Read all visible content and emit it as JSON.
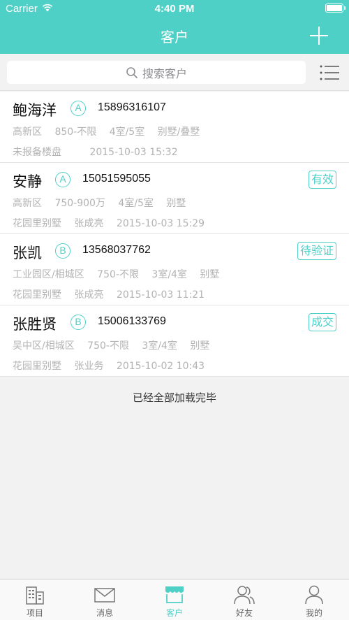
{
  "status_bar": {
    "carrier": "Carrier",
    "time": "4:40 PM"
  },
  "nav": {
    "title": "客户"
  },
  "search": {
    "placeholder": "搜索客户"
  },
  "customers": [
    {
      "name": "鲍海洋",
      "grade": "A",
      "phone": "15896316107",
      "district": "高新区",
      "budget": "850-不限",
      "rooms": "4室/5室",
      "type": "别墅/叠墅",
      "project": "未报备楼盘",
      "agent": "",
      "date": "2015-10-03 15:32",
      "status": ""
    },
    {
      "name": "安静",
      "grade": "A",
      "phone": "15051595055",
      "district": "高新区",
      "budget": "750-900万",
      "rooms": "4室/5室",
      "type": "别墅",
      "project": "花园里别墅",
      "agent": "张成亮",
      "date": "2015-10-03 15:29",
      "status": "有效"
    },
    {
      "name": "张凯",
      "grade": "B",
      "phone": "13568037762",
      "district": "工业园区/相城区",
      "budget": "750-不限",
      "rooms": "3室/4室",
      "type": "别墅",
      "project": "花园里别墅",
      "agent": "张成亮",
      "date": "2015-10-03 11:21",
      "status": "待验证"
    },
    {
      "name": "张胜贤",
      "grade": "B",
      "phone": "15006133769",
      "district": "吴中区/相城区",
      "budget": "750-不限",
      "rooms": "3室/4室",
      "type": "别墅",
      "project": "花园里别墅",
      "agent": "张业务",
      "date": "2015-10-02 10:43",
      "status": "成交"
    }
  ],
  "footer_note": "已经全部加载完毕",
  "tabs": [
    {
      "label": "项目",
      "icon": "building-icon"
    },
    {
      "label": "消息",
      "icon": "envelope-icon"
    },
    {
      "label": "客户",
      "icon": "storefront-icon"
    },
    {
      "label": "好友",
      "icon": "friends-icon"
    },
    {
      "label": "我的",
      "icon": "person-icon"
    }
  ],
  "colors": {
    "accent": "#4fd0c7",
    "meta_text": "#b3b3b3",
    "background": "#f2f2f2"
  }
}
